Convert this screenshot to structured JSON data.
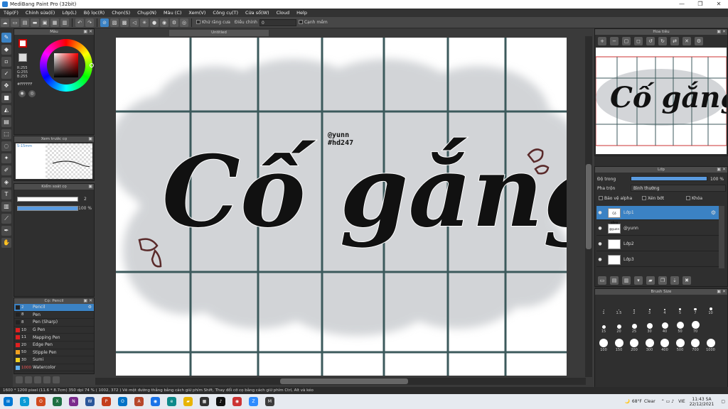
{
  "window": {
    "title": "MediBang Paint Pro (32bit)",
    "controls": [
      "—",
      "❐",
      "✕"
    ]
  },
  "menu": [
    "Tệp(F)",
    "Chỉnh sửa(E)",
    "Lớp(L)",
    "Bộ lọc(R)",
    "Chọn(S)",
    "Chụp(N)",
    "Màu (C)",
    "Xem(V)",
    "Công cụ(T)",
    "Cửa sổ(W)",
    "Cloud",
    "Help"
  ],
  "toolbar": {
    "antialias_label": "Khử răng cưa",
    "adjust_label": "Điều chỉnh",
    "adjust_value": "0",
    "edge_label": "Cạnh mềm"
  },
  "color_panel": {
    "title": "Màu",
    "r": "R:255",
    "g": "G:255",
    "b": "B:255",
    "hex": "#FFFFFF"
  },
  "preview_panel": {
    "title": "Xem trước cọ",
    "size_label": "5-15mm"
  },
  "brush_control": {
    "title": "Kiểm soát cọ",
    "size_value": "2",
    "opacity_value": "100 %"
  },
  "brush_list": {
    "title": "Cọ: Pencil",
    "items": [
      {
        "size": "2",
        "name": "Pencil",
        "color": "#222222"
      },
      {
        "size": "8",
        "name": "Pen",
        "color": "#222222"
      },
      {
        "size": "8",
        "name": "Pen (Sharp)",
        "color": "#222222"
      },
      {
        "size": "10",
        "name": "G Pen",
        "color": "#e02020"
      },
      {
        "size": "11",
        "name": "Mapping Pen",
        "color": "#e02020"
      },
      {
        "size": "20",
        "name": "Edge Pen",
        "color": "#e02020"
      },
      {
        "size": "50",
        "name": "Stipple Pen",
        "color": "#f0a020"
      },
      {
        "size": "30",
        "name": "Sumi",
        "color": "#f0d020"
      },
      {
        "size": "1000",
        "name": "Watercolor",
        "color": "#60b0f0"
      }
    ]
  },
  "document": {
    "tab": "Untitled",
    "main_text": "Cố gắng",
    "tag1": "@yunn",
    "tag2": "#hd247"
  },
  "navigator": {
    "title": "Hoa tiêu",
    "text": "Cố gắng"
  },
  "layer_panel": {
    "title": "Lớp",
    "opacity_label": "Độ trong",
    "opacity_value": "100 %",
    "blend_label": "Pha trộn",
    "blend_value": "Bình thường",
    "protect_alpha": "Bảo vệ alpha",
    "clipping": "Xén bớt",
    "lock": "Khóa",
    "layers": [
      {
        "name": "Lớp1",
        "thumb": "Cố gắng"
      },
      {
        "name": "@yunn",
        "thumb": "@yunn"
      },
      {
        "name": "Lớp2",
        "thumb": ""
      },
      {
        "name": "Lớp3",
        "thumb": ""
      }
    ]
  },
  "brush_size_panel": {
    "title": "Brush Size",
    "sizes": [
      "1",
      "1.5",
      "2",
      "3",
      "4",
      "5",
      "7",
      "10",
      "15",
      "20",
      "25",
      "30",
      "40",
      "50",
      "70",
      "100",
      "150",
      "200",
      "300",
      "400",
      "500",
      "700",
      "1000"
    ]
  },
  "status": "1600 * 1200 pixel   (11.6 * 8.7cm)   350 dpi   74 %   ( 1002, 372 )   Vẽ một đường thẳng bằng cách giữ phím Shift, Thay đổi cỡ cọ bằng cách giữ phím Ctrl, Alt và kéo",
  "taskbar": {
    "weather_temp": "68°F",
    "weather_text": "Clear",
    "lang": "VIE",
    "time": "11:43 SA",
    "date": "22/12/2021"
  }
}
